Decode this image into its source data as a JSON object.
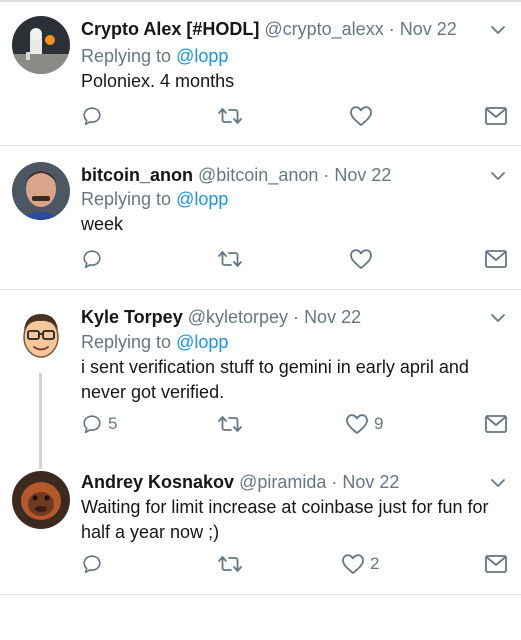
{
  "colors": {
    "link": "#1b95e0",
    "secondary": "#657786",
    "divider": "#e1e8ed",
    "text": "#14171a"
  },
  "tweets": [
    {
      "display_name": "Crypto Alex [#HODL]",
      "handle": "@crypto_alexx",
      "separator": "·",
      "date": "Nov 22",
      "replying_prefix": "Replying to",
      "replying_to": "@lopp",
      "text": "Poloniex. 4 months",
      "reply_count": "",
      "like_count": "",
      "avatar": "astronaut-moon-avatar"
    },
    {
      "display_name": "bitcoin_anon",
      "handle": "@bitcoin_anon",
      "separator": "·",
      "date": "Nov 22",
      "replying_prefix": "Replying to",
      "replying_to": "@lopp",
      "text": "week",
      "reply_count": "",
      "like_count": "",
      "avatar": "man-mustache-avatar"
    },
    {
      "display_name": "Kyle Torpey",
      "handle": "@kyletorpey",
      "separator": "·",
      "date": "Nov 22",
      "replying_prefix": "Replying to",
      "replying_to": "@lopp",
      "text": "i sent verification stuff to gemini in early april and never got verified.",
      "reply_count": "5",
      "like_count": "9",
      "avatar": "cartoon-face-avatar"
    },
    {
      "display_name": "Andrey Kosnakov",
      "handle": "@piramida",
      "separator": "·",
      "date": "Nov 22",
      "replying_prefix": "",
      "replying_to": "",
      "text": "Waiting for limit increase at coinbase just for fun for half a year now ;)",
      "reply_count": "",
      "like_count": "2",
      "avatar": "orangutan-avatar"
    }
  ]
}
